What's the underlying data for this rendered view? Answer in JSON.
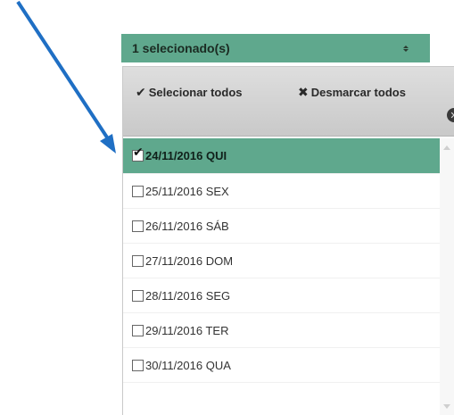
{
  "select": {
    "summary": "1 selecionado(s)"
  },
  "header": {
    "select_all_label": "Selecionar todos",
    "deselect_all_label": "Desmarcar todos"
  },
  "options": [
    {
      "label": "24/11/2016 QUI",
      "checked": true
    },
    {
      "label": "25/11/2016 SEX",
      "checked": false
    },
    {
      "label": "26/11/2016 SÁB",
      "checked": false
    },
    {
      "label": "27/11/2016 DOM",
      "checked": false
    },
    {
      "label": "28/11/2016 SEG",
      "checked": false
    },
    {
      "label": "29/11/2016 TER",
      "checked": false
    },
    {
      "label": "30/11/2016 QUA",
      "checked": false
    }
  ],
  "colors": {
    "accent": "#5fa88d",
    "annotation_arrow": "#1f6fc4"
  },
  "icons": {
    "select_all": "check-icon",
    "deselect_all": "x-icon",
    "close": "close-circle-icon",
    "toggle": "up-down-arrows-icon"
  }
}
